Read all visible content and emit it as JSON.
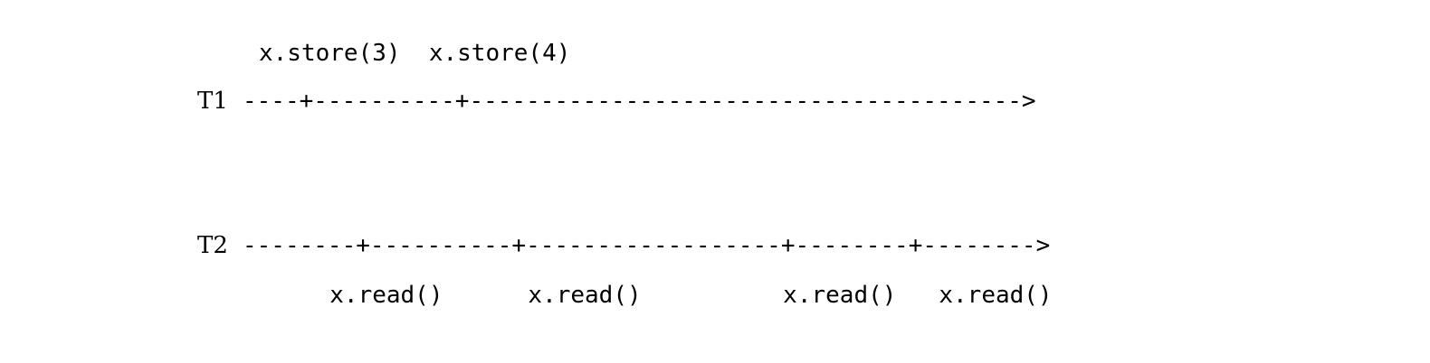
{
  "threads": [
    {
      "label": "T1",
      "timeline": "----+----------+--------------------------------------->",
      "ops_text": "x.store(3)  x.store(4)"
    },
    {
      "label": "T2",
      "timeline": "--------+----------+------------------+--------+-------->",
      "ops_text": "     x.read()      x.read()          x.read()   x.read()"
    }
  ]
}
